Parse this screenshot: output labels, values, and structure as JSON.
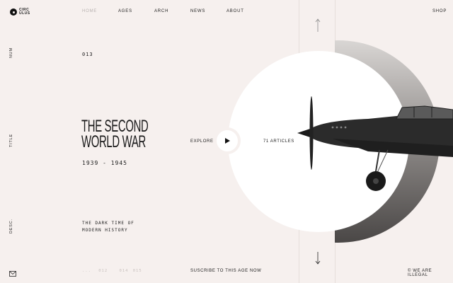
{
  "brand": {
    "line1": "CIRC",
    "line2": "ULUS"
  },
  "nav": [
    {
      "label": "HOME",
      "active": true
    },
    {
      "label": "AGES",
      "active": false
    },
    {
      "label": "ARCH",
      "active": false
    },
    {
      "label": "NEWS",
      "active": false
    },
    {
      "label": "ABOUT",
      "active": false
    }
  ],
  "shop_label": "SHOP",
  "side_labels": {
    "num": "NUM",
    "title": "TITLE",
    "desc": "DESC."
  },
  "number": "013",
  "title": {
    "line1": "THE SECOND",
    "line2": "WORLD WAR"
  },
  "years": "1939 - 1945",
  "description": {
    "line1": "THE DARK TIME OF",
    "line2": "MODERN HISTORY"
  },
  "explore_label": "EXPLORE",
  "articles_label": "71 ARTICLES",
  "pager": {
    "prev": "...",
    "first": "012",
    "current": "014",
    "next": "015"
  },
  "subscribe_label": "SUSCRIBE TO THIS AGE NOW",
  "footer_right": "© WE ARE ILLEGAL",
  "colors": {
    "background": "#f6f0ee",
    "text": "#222222",
    "muted": "#b8b2b0"
  }
}
